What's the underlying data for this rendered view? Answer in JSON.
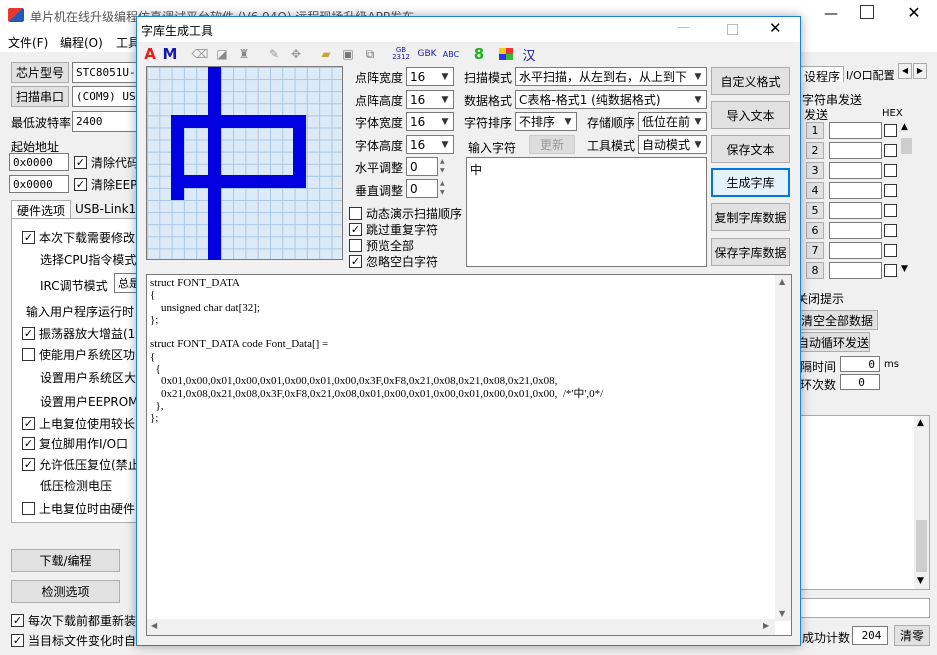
{
  "main_window": {
    "title": "单片机在线升级编程仿真调试平台软件 (V6.94Q) 远程现场升级APP发布",
    "menu": [
      "文件(F)",
      "编程(O)",
      "工具"
    ],
    "chip_type_label": "芯片型号",
    "chip_type_value": "STC8051U-3",
    "scan_port_label": "扫描串口",
    "port_value": "(COM9) USB",
    "min_baud_label": "最低波特率",
    "min_baud_value": "2400",
    "start_addr_label": "起始地址",
    "addr1_value": "0x0000",
    "clear_code_label": "清除代码",
    "addr2_value": "0x0000",
    "clear_eeprom_label": "清除EEPR",
    "tabs": [
      "硬件选项",
      "USB-Link1D"
    ],
    "options": {
      "opt1": "本次下载需要修改",
      "cpu_mode": "选择CPU指令模式",
      "irc_mode": "IRC调节模式",
      "irc_value": "总是",
      "run_freq": "输入用户程序运行时",
      "opt_amp": "振荡器放大增益(1",
      "opt_sysarea": "使能用户系统区功",
      "set_sys_size": "设置用户系统区大",
      "set_eeprom_size": "设置用户EEPROM大",
      "opt_reset_long": "上电复位使用较长",
      "opt_reset_io": "复位脚用作I/O口",
      "opt_lowvolt": "允许低压复位(禁止",
      "lowvolt_label": "低压检测电压",
      "opt_reset_hw": "上电复位时由硬件"
    },
    "download_btn": "下载/编程",
    "detect_btn": "检测选项",
    "reload_each": "每次下载前都重新装",
    "reload_change": "当目标文件变化时自动",
    "right_tabs": [
      "设程序",
      "I/O口配置"
    ],
    "serial_title": "字符串发送",
    "serial_send": "发送",
    "serial_hex": "HEX",
    "serial_rows": [
      "1",
      "2",
      "3",
      "4",
      "5",
      "6",
      "7",
      "8"
    ],
    "close_tip": "关闭提示",
    "clear_all_btn": "清空全部数据",
    "auto_loop_btn": "自动循环发送",
    "interval_label": "隔时间",
    "interval_value": "0",
    "interval_unit": "ms",
    "loop_count_label": "环次数",
    "loop_count_value": "0",
    "success_count_label": "成功计数",
    "success_count_value": "204",
    "clear_btn": "清零"
  },
  "dialog": {
    "title": "字库生成工具",
    "toolbar_gb": "GB\n2312",
    "toolbar_gbk": "GBK",
    "toolbar_abc": "ABC",
    "toolbar_8": "8",
    "toolbar_han": "汉",
    "dot_width_label": "点阵宽度",
    "dot_width_value": "16",
    "dot_height_label": "点阵高度",
    "dot_height_value": "16",
    "font_width_label": "字体宽度",
    "font_width_value": "16",
    "font_height_label": "字体高度",
    "font_height_value": "16",
    "h_adjust_label": "水平调整",
    "h_adjust_value": "0",
    "v_adjust_label": "垂直调整",
    "v_adjust_value": "0",
    "scan_mode_label": "扫描模式",
    "scan_mode_value": "水平扫描，从左到右，从上到下",
    "data_format_label": "数据格式",
    "data_format_value": "C表格-格式1 (纯数据格式)",
    "char_order_label": "字符排序",
    "char_order_value": "不排序",
    "storage_order_label": "存储顺序",
    "storage_order_value": "低位在前",
    "input_char_label": "输入字符",
    "update_btn": "更新",
    "tool_mode_label": "工具模式",
    "tool_mode_value": "自动模式",
    "input_text": "中",
    "custom_format_btn": "自定义格式",
    "import_text_btn": "导入文本",
    "save_text_btn": "保存文本",
    "generate_btn": "生成字库",
    "copy_data_btn": "复制字库数据",
    "save_data_btn": "保存字库数据",
    "chk_dynamic": "动态演示扫描顺序",
    "chk_skip_dup": "跳过重复字符",
    "chk_preview_all": "预览全部",
    "chk_ignore_blank": "忽略空白字符",
    "glyph_pixels": [
      [
        5,
        0
      ],
      [
        5,
        1
      ],
      [
        5,
        2
      ],
      [
        5,
        3
      ],
      [
        2,
        4
      ],
      [
        3,
        4
      ],
      [
        4,
        4
      ],
      [
        5,
        4
      ],
      [
        6,
        4
      ],
      [
        7,
        4
      ],
      [
        8,
        4
      ],
      [
        9,
        4
      ],
      [
        10,
        4
      ],
      [
        11,
        4
      ],
      [
        12,
        4
      ],
      [
        2,
        5
      ],
      [
        5,
        5
      ],
      [
        12,
        5
      ],
      [
        2,
        6
      ],
      [
        5,
        6
      ],
      [
        12,
        6
      ],
      [
        2,
        7
      ],
      [
        5,
        7
      ],
      [
        12,
        7
      ],
      [
        2,
        8
      ],
      [
        5,
        8
      ],
      [
        12,
        8
      ],
      [
        2,
        9
      ],
      [
        3,
        9
      ],
      [
        4,
        9
      ],
      [
        5,
        9
      ],
      [
        6,
        9
      ],
      [
        7,
        9
      ],
      [
        8,
        9
      ],
      [
        9,
        9
      ],
      [
        10,
        9
      ],
      [
        11,
        9
      ],
      [
        12,
        9
      ],
      [
        2,
        10
      ],
      [
        5,
        10
      ],
      [
        5,
        11
      ],
      [
        5,
        12
      ],
      [
        5,
        13
      ],
      [
        5,
        14
      ],
      [
        5,
        15
      ]
    ],
    "code": "struct FONT_DATA\n{\n    unsigned char dat[32];\n};\n\nstruct FONT_DATA code Font_Data[] =\n{\n  {\n    0x01,0x00,0x01,0x00,0x01,0x00,0x01,0x00,0x3F,0xF8,0x21,0x08,0x21,0x08,0x21,0x08,\n    0x21,0x08,0x21,0x08,0x3F,0xF8,0x21,0x08,0x01,0x00,0x01,0x00,0x01,0x00,0x01,0x00,  /*'中',0*/\n  },\n};"
  }
}
